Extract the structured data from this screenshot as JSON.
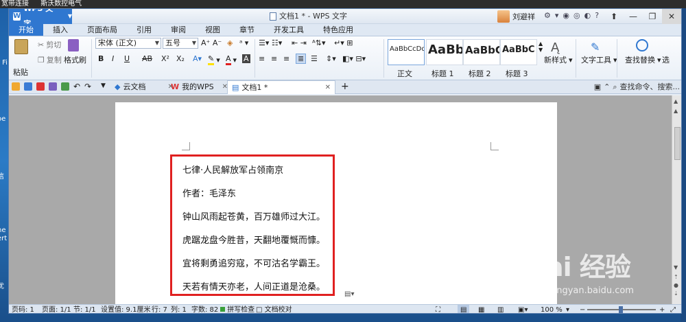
{
  "desktop": {
    "top_items": [
      "宽带连接",
      "斯沃数控电气"
    ],
    "left_labels": [
      "t Fi",
      "oe",
      "信",
      "ne",
      "ert",
      "优"
    ]
  },
  "window": {
    "app_name": "WPS 文字",
    "title": "文档1 * - WPS 文字",
    "user": "刘避祥",
    "controls": {
      "help": "?"
    }
  },
  "ribbon_tabs": [
    "开始",
    "插入",
    "页面布局",
    "引用",
    "审阅",
    "视图",
    "章节",
    "开发工具",
    "特色应用"
  ],
  "ribbon": {
    "paste": "粘贴",
    "cut": "剪切",
    "copy": "复制",
    "format_painter": "格式刷",
    "font_name": "宋体 (正文)",
    "font_size": "五号",
    "bold": "B",
    "italic": "I",
    "underline": "U",
    "strike": "AB",
    "superscript": "X²",
    "subscript": "X₂",
    "styles": [
      {
        "sample": "AaBbCcDd",
        "name": "正文"
      },
      {
        "sample": "AaBb",
        "name": "标题 1"
      },
      {
        "sample": "AaBbC",
        "name": "标题 2"
      },
      {
        "sample": "AaBbC",
        "name": "标题 3"
      }
    ],
    "new_style": "新样式",
    "text_tools": "文字工具",
    "find_replace": "查找替换",
    "select": "选"
  },
  "doc_tabs": {
    "cloud": "云文档",
    "mywps": "我的WPS",
    "doc": "文档1 *",
    "search_placeholder": "查找命令、搜索..."
  },
  "document": {
    "lines": [
      "七律·人民解放军占领南京",
      "作者：毛泽东",
      "钟山风雨起苍黄，百万雄师过大江。",
      "虎踞龙盘今胜昔，天翻地覆慨而慷。",
      "宜将剩勇追穷寇，不可沽名学霸王。",
      "天若有情天亦老，人间正道是沧桑。"
    ]
  },
  "status": {
    "page_no": "页码: 1",
    "pages": "页面: 1/1",
    "section": "节: 1/1",
    "setting": "设置值: 9.1厘米",
    "row": "行: 7",
    "col": "列: 1",
    "words": "字数: 82",
    "spell": "拼写检查",
    "proof": "文档校对",
    "zoom": "100 %"
  },
  "watermark": {
    "brand": "Bai 经验",
    "url": "jingyan.baidu.com"
  },
  "colors": {
    "accent": "#2f77d0",
    "highlight_box": "#e02020"
  }
}
